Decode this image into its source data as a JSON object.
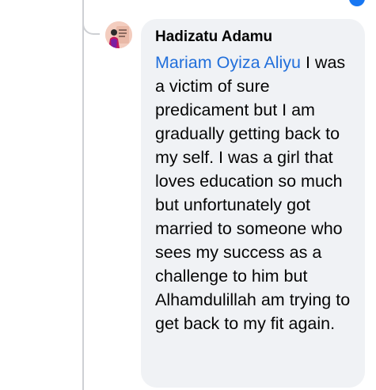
{
  "comment": {
    "author": "Hadizatu Adamu",
    "mention": "Mariam Oyiza Aliyu",
    "text": " I was a victim of sure predicament but I am gradually getting back to my self. I was a girl that loves education so much but unfortunately got married to someone who sees my success as a challenge to him but Alhamdulillah  am trying to get back to my fit again."
  },
  "avatar_icon": "profile-photo-icon",
  "colors": {
    "bubble": "#f0f2f5",
    "mention": "#216fdb",
    "text": "#050505",
    "thread_line": "#ced0d4",
    "accent": "#1877f2"
  }
}
